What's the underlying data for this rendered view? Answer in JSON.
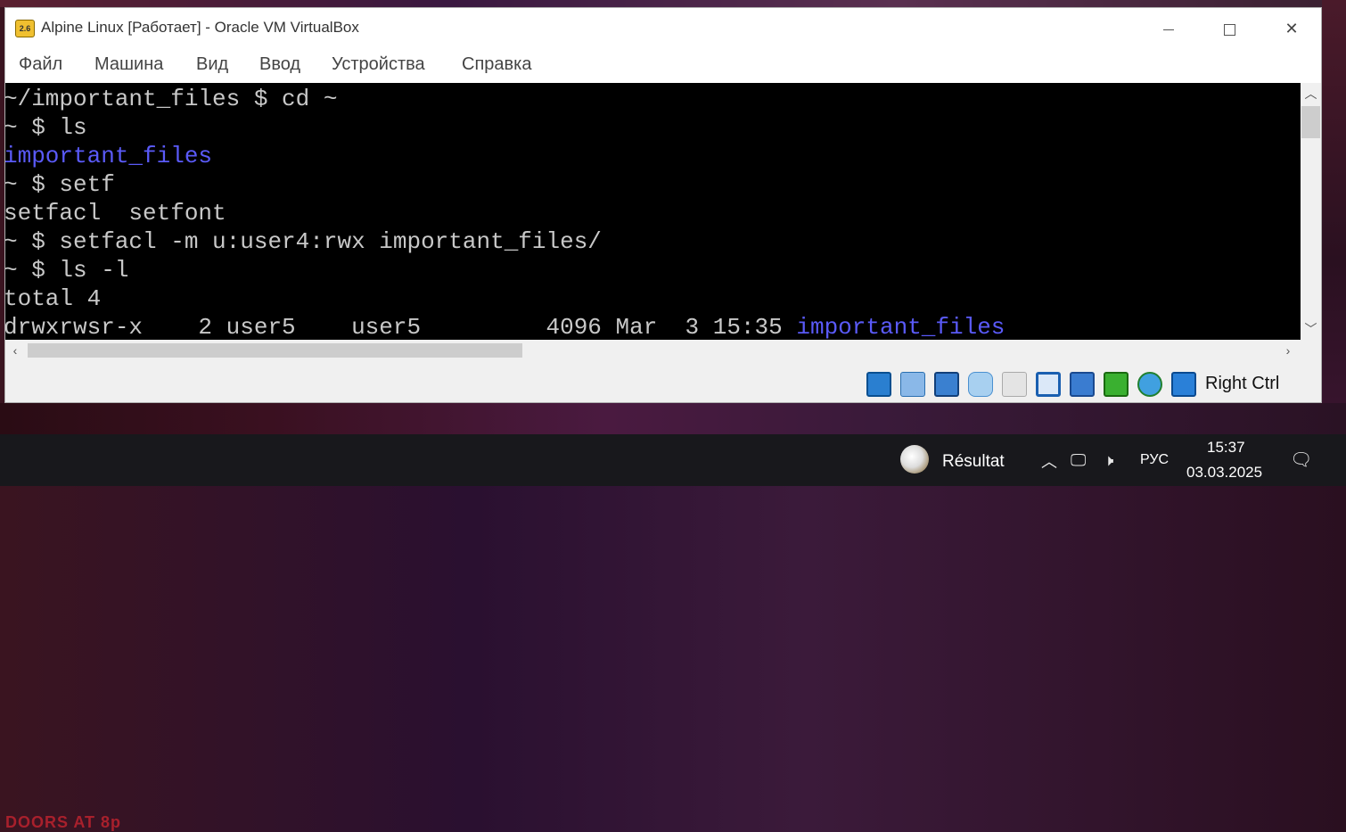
{
  "window": {
    "title": "Alpine Linux [Работает] - Oracle VM VirtualBox",
    "app_icon_text": "2.6"
  },
  "menu": {
    "items": [
      "Файл",
      "Машина",
      "Вид",
      "Ввод",
      "Устройства",
      "Справка"
    ]
  },
  "terminal": {
    "lines": [
      {
        "segments": [
          {
            "text": "~/important_files $ cd ~",
            "color": "normal"
          }
        ]
      },
      {
        "segments": [
          {
            "text": "~ $ ls",
            "color": "normal"
          }
        ]
      },
      {
        "segments": [
          {
            "text": "important_files",
            "color": "blue"
          }
        ]
      },
      {
        "segments": [
          {
            "text": "~ $ setf",
            "color": "normal"
          }
        ]
      },
      {
        "segments": [
          {
            "text": "setfacl  setfont",
            "color": "normal"
          }
        ]
      },
      {
        "segments": [
          {
            "text": "~ $ setfacl -m u:user4:rwx important_files/",
            "color": "normal"
          }
        ]
      },
      {
        "segments": [
          {
            "text": "~ $ ls -l",
            "color": "normal"
          }
        ]
      },
      {
        "segments": [
          {
            "text": "total 4",
            "color": "normal"
          }
        ]
      },
      {
        "segments": [
          {
            "text": "drwxrwsr-x    2 user5    user5         4096 Mar  3 15:35 ",
            "color": "normal"
          },
          {
            "text": "important_files",
            "color": "blue"
          }
        ]
      }
    ],
    "colors": {
      "normal": "#c8c8c8",
      "blue": "#5a5af8",
      "background": "#000000"
    }
  },
  "statusbar": {
    "icons": [
      "optical-drive-icon",
      "audio-icon",
      "network-icon",
      "usb-icon",
      "shared-folders-icon",
      "display-icon",
      "video-capture-icon",
      "cpu-icon",
      "mouse-integration-icon",
      "keyboard-capture-icon"
    ],
    "host_key": "Right Ctrl"
  },
  "taskbar": {
    "widget_label": "Résultat",
    "language": "РУС",
    "time": "15:37",
    "date": "03.03.2025"
  }
}
